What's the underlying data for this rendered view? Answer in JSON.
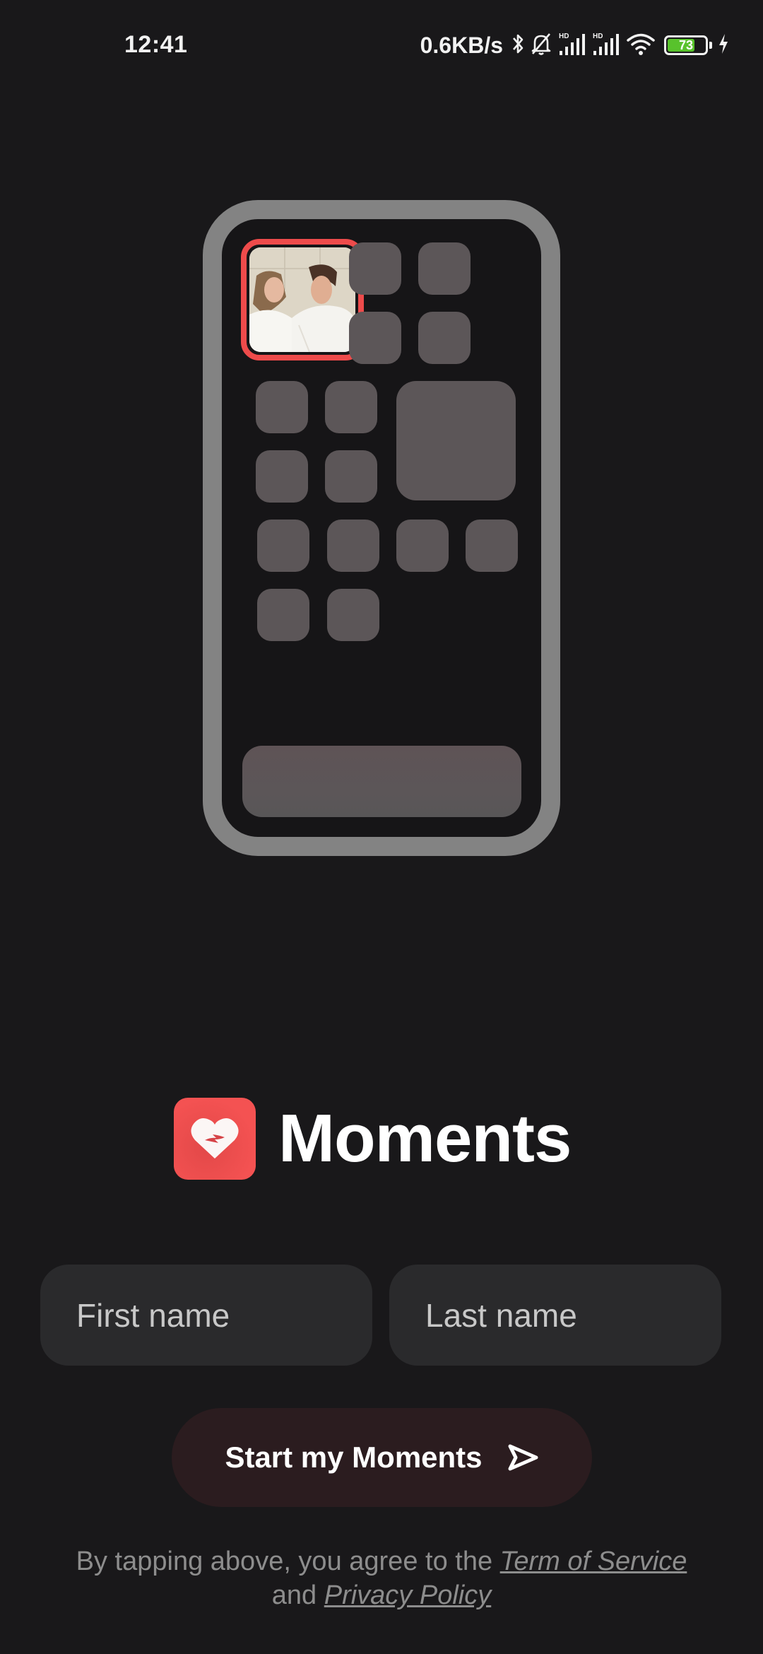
{
  "status_bar": {
    "time": "12:41",
    "net_speed": "0.6KB/s",
    "icons": [
      "bluetooth-icon",
      "bell-off-icon",
      "signal-hd-icon",
      "signal-hd-icon",
      "wifi-icon",
      "battery-icon",
      "charging-icon"
    ],
    "signal_label": "HD",
    "battery_percent": 73,
    "battery_label": "73",
    "battery_color": "#58c22c"
  },
  "illustration": {
    "description": "phone home screen with highlighted photo widget",
    "accent_border": "#ee4b4b"
  },
  "brand": {
    "icon": "heart-icon",
    "title": "Moments",
    "icon_color": "#f45252"
  },
  "form": {
    "first_name": {
      "value": "",
      "placeholder": "First name"
    },
    "last_name": {
      "value": "",
      "placeholder": "Last name"
    },
    "submit_label": "Start my Moments",
    "submit_icon": "send-icon"
  },
  "legal": {
    "prefix": "By tapping above, you agree to the ",
    "terms_link": "Term of Service",
    "middle": "and ",
    "privacy_link": "Privacy Policy"
  }
}
